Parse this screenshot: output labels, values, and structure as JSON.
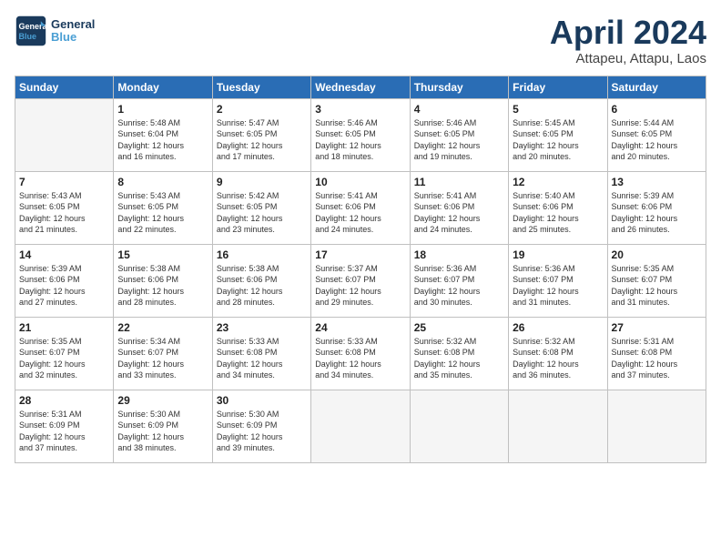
{
  "header": {
    "logo_line1": "General",
    "logo_line2": "Blue",
    "month_title": "April 2024",
    "location": "Attapeu, Attapu, Laos"
  },
  "days_of_week": [
    "Sunday",
    "Monday",
    "Tuesday",
    "Wednesday",
    "Thursday",
    "Friday",
    "Saturday"
  ],
  "weeks": [
    [
      {
        "day": "",
        "info": ""
      },
      {
        "day": "1",
        "info": "Sunrise: 5:48 AM\nSunset: 6:04 PM\nDaylight: 12 hours\nand 16 minutes."
      },
      {
        "day": "2",
        "info": "Sunrise: 5:47 AM\nSunset: 6:05 PM\nDaylight: 12 hours\nand 17 minutes."
      },
      {
        "day": "3",
        "info": "Sunrise: 5:46 AM\nSunset: 6:05 PM\nDaylight: 12 hours\nand 18 minutes."
      },
      {
        "day": "4",
        "info": "Sunrise: 5:46 AM\nSunset: 6:05 PM\nDaylight: 12 hours\nand 19 minutes."
      },
      {
        "day": "5",
        "info": "Sunrise: 5:45 AM\nSunset: 6:05 PM\nDaylight: 12 hours\nand 20 minutes."
      },
      {
        "day": "6",
        "info": "Sunrise: 5:44 AM\nSunset: 6:05 PM\nDaylight: 12 hours\nand 20 minutes."
      }
    ],
    [
      {
        "day": "7",
        "info": "Sunrise: 5:43 AM\nSunset: 6:05 PM\nDaylight: 12 hours\nand 21 minutes."
      },
      {
        "day": "8",
        "info": "Sunrise: 5:43 AM\nSunset: 6:05 PM\nDaylight: 12 hours\nand 22 minutes."
      },
      {
        "day": "9",
        "info": "Sunrise: 5:42 AM\nSunset: 6:05 PM\nDaylight: 12 hours\nand 23 minutes."
      },
      {
        "day": "10",
        "info": "Sunrise: 5:41 AM\nSunset: 6:06 PM\nDaylight: 12 hours\nand 24 minutes."
      },
      {
        "day": "11",
        "info": "Sunrise: 5:41 AM\nSunset: 6:06 PM\nDaylight: 12 hours\nand 24 minutes."
      },
      {
        "day": "12",
        "info": "Sunrise: 5:40 AM\nSunset: 6:06 PM\nDaylight: 12 hours\nand 25 minutes."
      },
      {
        "day": "13",
        "info": "Sunrise: 5:39 AM\nSunset: 6:06 PM\nDaylight: 12 hours\nand 26 minutes."
      }
    ],
    [
      {
        "day": "14",
        "info": "Sunrise: 5:39 AM\nSunset: 6:06 PM\nDaylight: 12 hours\nand 27 minutes."
      },
      {
        "day": "15",
        "info": "Sunrise: 5:38 AM\nSunset: 6:06 PM\nDaylight: 12 hours\nand 28 minutes."
      },
      {
        "day": "16",
        "info": "Sunrise: 5:38 AM\nSunset: 6:06 PM\nDaylight: 12 hours\nand 28 minutes."
      },
      {
        "day": "17",
        "info": "Sunrise: 5:37 AM\nSunset: 6:07 PM\nDaylight: 12 hours\nand 29 minutes."
      },
      {
        "day": "18",
        "info": "Sunrise: 5:36 AM\nSunset: 6:07 PM\nDaylight: 12 hours\nand 30 minutes."
      },
      {
        "day": "19",
        "info": "Sunrise: 5:36 AM\nSunset: 6:07 PM\nDaylight: 12 hours\nand 31 minutes."
      },
      {
        "day": "20",
        "info": "Sunrise: 5:35 AM\nSunset: 6:07 PM\nDaylight: 12 hours\nand 31 minutes."
      }
    ],
    [
      {
        "day": "21",
        "info": "Sunrise: 5:35 AM\nSunset: 6:07 PM\nDaylight: 12 hours\nand 32 minutes."
      },
      {
        "day": "22",
        "info": "Sunrise: 5:34 AM\nSunset: 6:07 PM\nDaylight: 12 hours\nand 33 minutes."
      },
      {
        "day": "23",
        "info": "Sunrise: 5:33 AM\nSunset: 6:08 PM\nDaylight: 12 hours\nand 34 minutes."
      },
      {
        "day": "24",
        "info": "Sunrise: 5:33 AM\nSunset: 6:08 PM\nDaylight: 12 hours\nand 34 minutes."
      },
      {
        "day": "25",
        "info": "Sunrise: 5:32 AM\nSunset: 6:08 PM\nDaylight: 12 hours\nand 35 minutes."
      },
      {
        "day": "26",
        "info": "Sunrise: 5:32 AM\nSunset: 6:08 PM\nDaylight: 12 hours\nand 36 minutes."
      },
      {
        "day": "27",
        "info": "Sunrise: 5:31 AM\nSunset: 6:08 PM\nDaylight: 12 hours\nand 37 minutes."
      }
    ],
    [
      {
        "day": "28",
        "info": "Sunrise: 5:31 AM\nSunset: 6:09 PM\nDaylight: 12 hours\nand 37 minutes."
      },
      {
        "day": "29",
        "info": "Sunrise: 5:30 AM\nSunset: 6:09 PM\nDaylight: 12 hours\nand 38 minutes."
      },
      {
        "day": "30",
        "info": "Sunrise: 5:30 AM\nSunset: 6:09 PM\nDaylight: 12 hours\nand 39 minutes."
      },
      {
        "day": "",
        "info": ""
      },
      {
        "day": "",
        "info": ""
      },
      {
        "day": "",
        "info": ""
      },
      {
        "day": "",
        "info": ""
      }
    ]
  ]
}
